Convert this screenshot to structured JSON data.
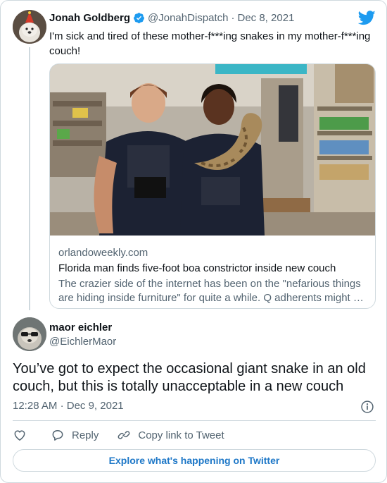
{
  "colors": {
    "accent": "#1d9bf0",
    "link_blue": "#1d77c7",
    "text": "#0f1419",
    "muted": "#536471",
    "border": "#cfd9de"
  },
  "quoted_tweet": {
    "author_name": "Jonah Goldberg",
    "verified_icon": "verified-badge-icon",
    "handle": "@JonahDispatch",
    "separator": "·",
    "date": "Dec 8, 2021",
    "text": "I'm sick and tired of these mother-f***ing snakes in my mother-f***ing couch!",
    "link_card": {
      "image_description_icon": "news-photo",
      "domain": "orlandoweekly.com",
      "title": "Florida man finds five-foot boa constrictor inside new couch",
      "description": "The crazier side of the internet has been on the \"nefarious things are hiding inside furniture\" for quite a while. Q adherents might …"
    }
  },
  "main_tweet": {
    "author_name": "maor eichler",
    "handle": "@EichlerMaor",
    "text": "You’ve got to expect the occasional giant snake in an old couch, but this is totally unacceptable in a new couch",
    "time": "12:28 AM",
    "separator": "·",
    "date": "Dec 9, 2021"
  },
  "actions": {
    "like_icon": "heart-icon",
    "reply_label": "Reply",
    "copy_link_label": "Copy link to Tweet"
  },
  "explore_button": {
    "label": "Explore what's happening on Twitter"
  },
  "brand_icon": "twitter-bird-icon"
}
